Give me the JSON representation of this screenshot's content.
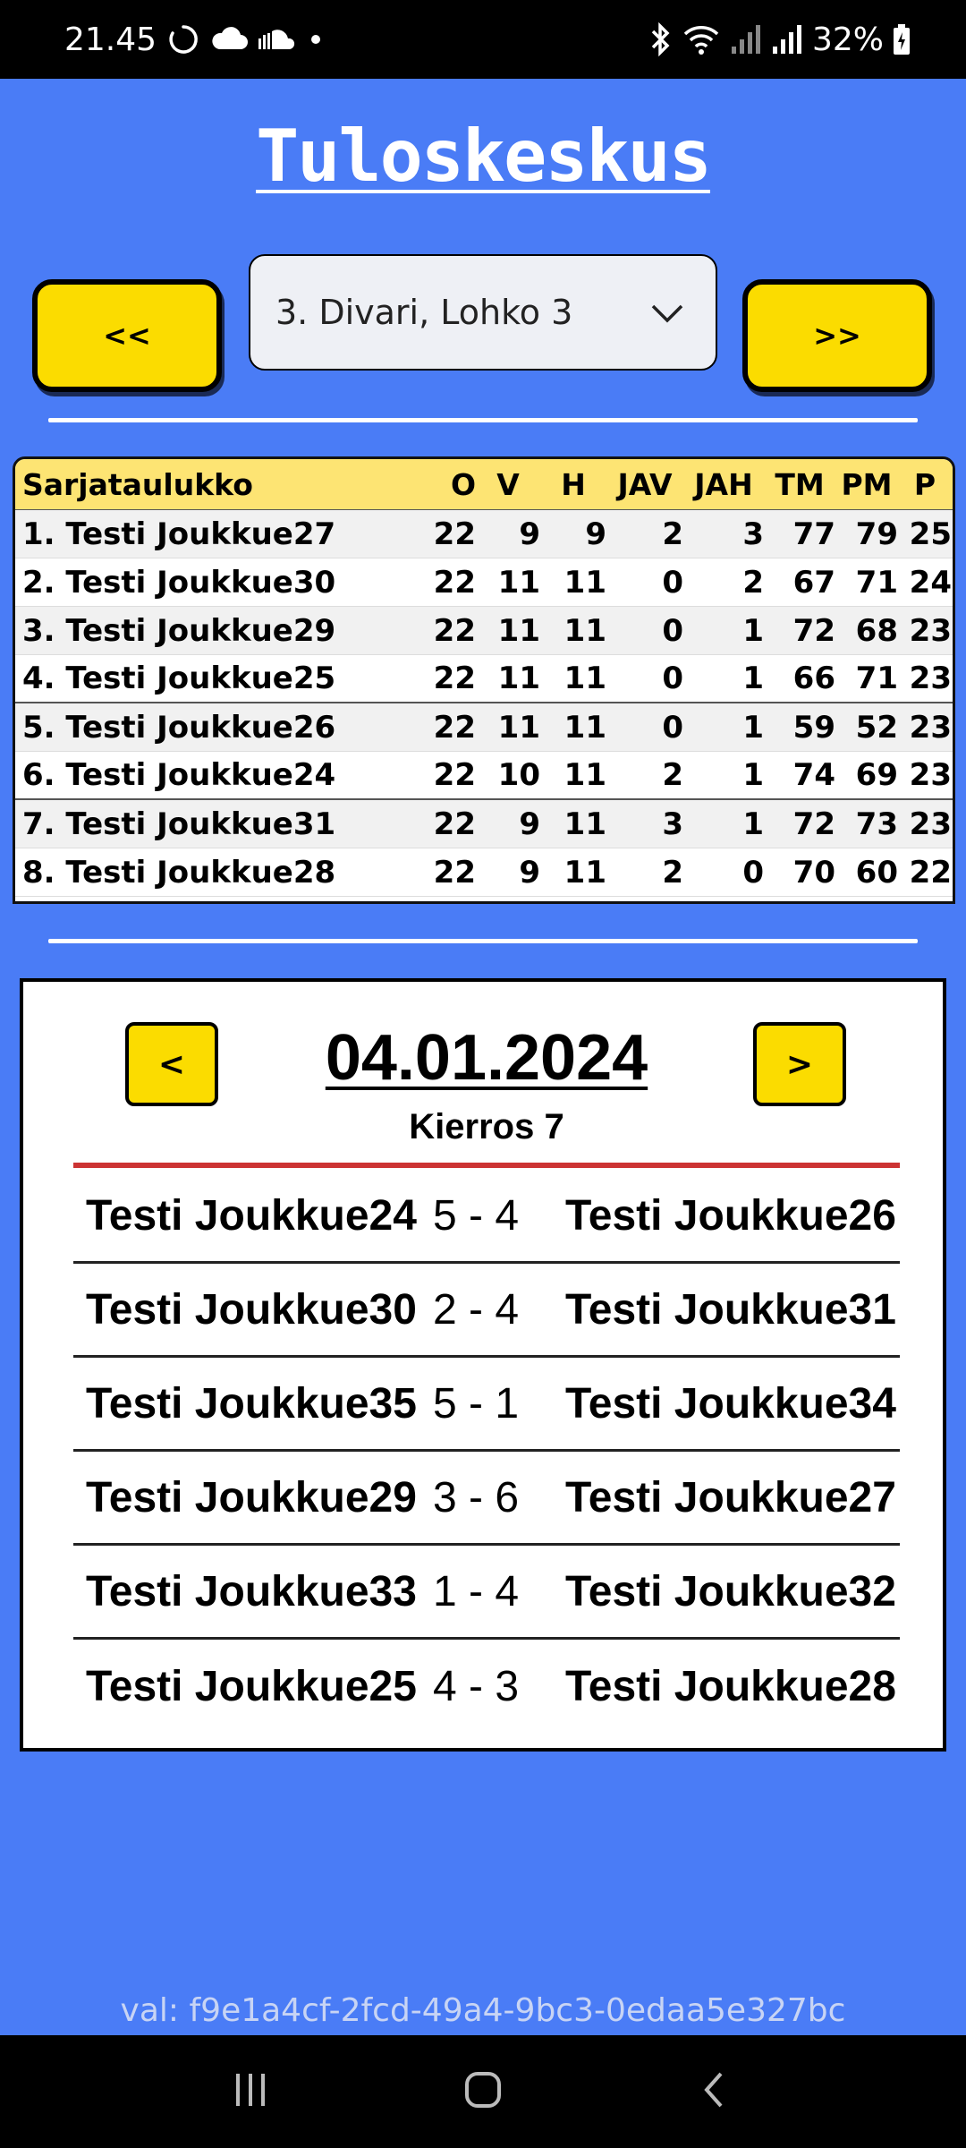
{
  "status_bar": {
    "time": "21.45",
    "battery": "32%"
  },
  "app": {
    "title": "Tuloskeskus"
  },
  "league_nav": {
    "prev_label": "<<",
    "next_label": ">>",
    "selected": "3. Divari, Lohko 3"
  },
  "standings": {
    "headers": [
      "Sarjataulukko",
      "O",
      "V",
      "H",
      "JAV",
      "JAH",
      "TM",
      "PM",
      "P"
    ],
    "rows": [
      {
        "name": "1. Testi Joukkue27",
        "o": "22",
        "v": "9",
        "h": "9",
        "jav": "2",
        "jah": "3",
        "tm": "77",
        "pm": "79",
        "p": "25"
      },
      {
        "name": "2. Testi Joukkue30",
        "o": "22",
        "v": "11",
        "h": "11",
        "jav": "0",
        "jah": "2",
        "tm": "67",
        "pm": "71",
        "p": "24"
      },
      {
        "name": "3. Testi Joukkue29",
        "o": "22",
        "v": "11",
        "h": "11",
        "jav": "0",
        "jah": "1",
        "tm": "72",
        "pm": "68",
        "p": "23"
      },
      {
        "name": "4. Testi Joukkue25",
        "o": "22",
        "v": "11",
        "h": "11",
        "jav": "0",
        "jah": "1",
        "tm": "66",
        "pm": "71",
        "p": "23"
      },
      {
        "name": "5. Testi Joukkue26",
        "o": "22",
        "v": "11",
        "h": "11",
        "jav": "0",
        "jah": "1",
        "tm": "59",
        "pm": "52",
        "p": "23"
      },
      {
        "name": "6. Testi Joukkue24",
        "o": "22",
        "v": "10",
        "h": "11",
        "jav": "2",
        "jah": "1",
        "tm": "74",
        "pm": "69",
        "p": "23"
      },
      {
        "name": "7. Testi Joukkue31",
        "o": "22",
        "v": "9",
        "h": "11",
        "jav": "3",
        "jah": "1",
        "tm": "72",
        "pm": "73",
        "p": "23"
      },
      {
        "name": "8. Testi Joukkue28",
        "o": "22",
        "v": "9",
        "h": "11",
        "jav": "2",
        "jah": "0",
        "tm": "70",
        "pm": "60",
        "p": "22"
      }
    ]
  },
  "matches": {
    "prev_label": "<",
    "next_label": ">",
    "date": "04.01.2024",
    "round": "Kierros 7",
    "games": [
      {
        "home": "Testi Joukkue24",
        "score": "5 - 4",
        "away": "Testi Joukkue26"
      },
      {
        "home": "Testi Joukkue30",
        "score": "2 - 4",
        "away": "Testi Joukkue31"
      },
      {
        "home": "Testi Joukkue35",
        "score": "5 - 1",
        "away": "Testi Joukkue34"
      },
      {
        "home": "Testi Joukkue29",
        "score": "3 - 6",
        "away": "Testi Joukkue27"
      },
      {
        "home": "Testi Joukkue33",
        "score": "1 - 4",
        "away": "Testi Joukkue32"
      },
      {
        "home": "Testi Joukkue25",
        "score": "4 - 3",
        "away": "Testi Joukkue28"
      }
    ]
  },
  "footer": {
    "id_text": "val: f9e1a4cf-2fcd-49a4-9bc3-0edaa5e327bc"
  },
  "colors": {
    "background": "#4a7cf6",
    "button_yellow": "#fbdc00",
    "table_header": "#fde473",
    "accent_red": "#cc3333"
  }
}
